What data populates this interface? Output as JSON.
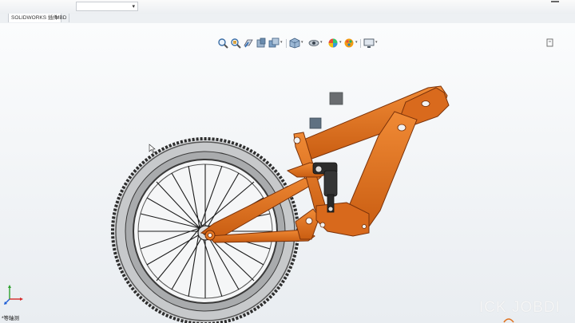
{
  "window": {
    "tabs": [
      {
        "label": "SOLIDWORKS 插件",
        "active": true
      },
      {
        "label": "MBD",
        "active": false
      }
    ]
  },
  "hud_toolbar": {
    "tools": [
      {
        "icon": "zoom-to-fit-icon"
      },
      {
        "icon": "zoom-to-area-icon"
      },
      {
        "icon": "previous-view-icon"
      },
      {
        "icon": "section-view-icon"
      },
      {
        "icon": "dynamic-annotation-views-icon"
      },
      {
        "icon": "view-orientation-icon"
      },
      {
        "icon": "display-style-icon"
      },
      {
        "icon": "hide-show-items-icon"
      },
      {
        "icon": "edit-appearance-icon"
      },
      {
        "icon": "apply-scene-icon"
      },
      {
        "icon": "view-settings-icon"
      }
    ]
  },
  "status": {
    "footer_label": "*等轴测"
  },
  "watermark": {
    "text": "ICK JOBDI"
  },
  "colors": {
    "frame_orange": "#e0721f",
    "frame_dark": "#a8460c",
    "tire": "#3b3b3b",
    "shock_body": "#2b2b2b",
    "viewport_top": "#fbfcfd",
    "viewport_bottom": "#e9edf1"
  }
}
